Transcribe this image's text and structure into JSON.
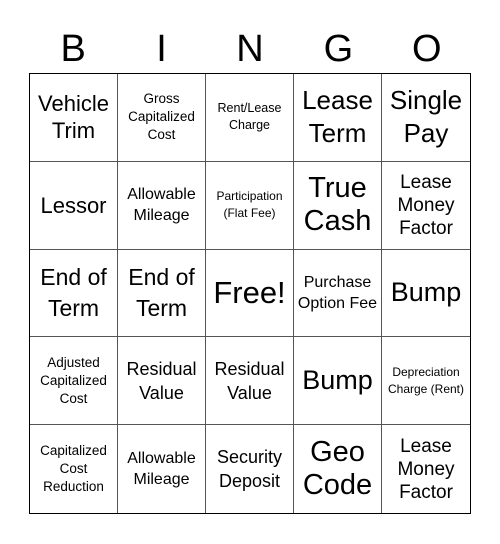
{
  "header": {
    "letters": [
      "B",
      "I",
      "N",
      "G",
      "O"
    ]
  },
  "card": {
    "rows": [
      [
        "Vehicle Trim",
        "Gross Capitalized Cost",
        "Rent/Lease Charge",
        "Lease Term",
        "Single Pay"
      ],
      [
        "Lessor",
        "Allowable Mileage",
        "Participation (Flat Fee)",
        "True Cash",
        "Lease Money Factor"
      ],
      [
        "End of Term",
        "End of Term",
        "Free!",
        "Purchase Option Fee",
        "Bump"
      ],
      [
        "Adjusted Capitalized Cost",
        "Residual Value",
        "Residual Value",
        "Bump",
        "Depreciation Charge (Rent)"
      ],
      [
        "Capitalized Cost Reduction",
        "Allowable Mileage",
        "Security Deposit",
        "Geo Code",
        "Lease Money Factor"
      ]
    ]
  }
}
